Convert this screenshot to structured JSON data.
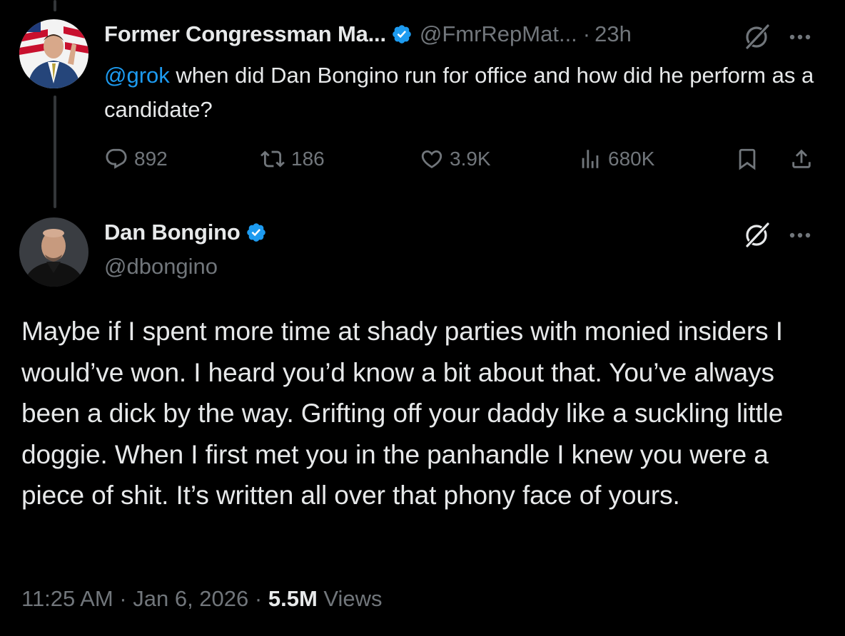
{
  "reply_tweet": {
    "author": {
      "display_name": "Former Congressman Ma...",
      "handle": "@FmrRepMat...",
      "verified": true
    },
    "time": "23h",
    "separator": "·",
    "text": {
      "mention": "@grok",
      "body": " when did Dan Bongino run for office and how did he perform as a candidate?"
    },
    "actions": {
      "replies": "892",
      "reposts": "186",
      "likes": "3.9K",
      "views": "680K"
    }
  },
  "main_tweet": {
    "author": {
      "display_name": "Dan Bongino",
      "handle": "@dbongino",
      "verified": true
    },
    "text": "Maybe if I spent more time at shady parties with monied insiders I would’ve won. I heard you’d know a bit about that. You’ve always been a dick by the way. Grifting off your daddy like a suckling little doggie. When I first met you in the panhandle I knew you were a piece of shit. It’s written all over that phony face of yours.",
    "meta": {
      "time": "11:25 AM",
      "sep1": " · ",
      "date": "Jan 6, 2026",
      "sep2": " · ",
      "views_count": "5.5M",
      "views_label": " Views"
    }
  },
  "colors": {
    "background": "#000000",
    "text": "#e7e9ea",
    "muted": "#71767b",
    "accent": "#1d9bf0"
  },
  "icons": [
    "verified-badge-icon",
    "grok-icon",
    "more-icon",
    "reply-icon",
    "repost-icon",
    "like-icon",
    "views-icon",
    "bookmark-icon",
    "share-icon"
  ]
}
